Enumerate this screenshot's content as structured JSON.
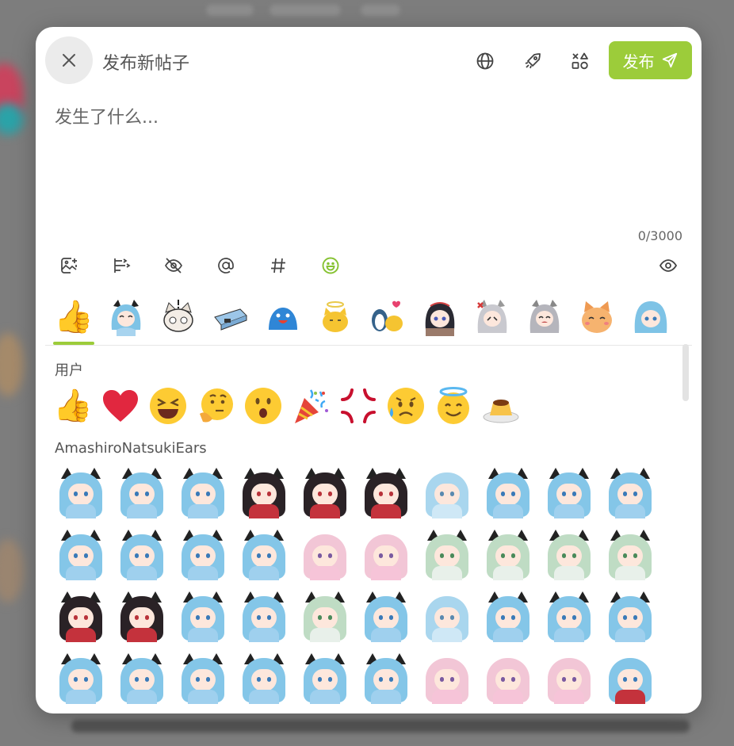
{
  "header": {
    "title": "发布新帖子",
    "publish_label": "发布",
    "icons": [
      "close-icon",
      "globe-icon",
      "rocket-icon",
      "shapes-icon",
      "send-icon"
    ]
  },
  "editor": {
    "placeholder": "发生了什么...",
    "value": "",
    "counter": "0/3000"
  },
  "toolbar": {
    "icons": [
      "add-image-icon",
      "poll-icon",
      "hide-icon",
      "mention-icon",
      "hashtag-icon",
      "emoji-icon",
      "preview-eye-icon"
    ],
    "active_icon": "emoji-icon"
  },
  "emoji_picker": {
    "pack_tabs": [
      {
        "name": "user-pack",
        "icon": "thumbs-up-emoji",
        "active": true
      },
      {
        "name": "AmashiroNatsukiEars",
        "icon": "blue-hair-girl-sticker"
      },
      {
        "name": "pack-3",
        "icon": "cat-surprised-sticker"
      },
      {
        "name": "pack-4",
        "icon": "box-robot-sticker"
      },
      {
        "name": "pack-5",
        "icon": "blue-bird-sticker"
      },
      {
        "name": "pack-6",
        "icon": "yellow-angel-cat-sticker"
      },
      {
        "name": "pack-7",
        "icon": "penguin-heart-sticker"
      },
      {
        "name": "pack-8",
        "icon": "dark-hair-girl-sticker"
      },
      {
        "name": "pack-9",
        "icon": "silver-hair-angry-sticker"
      },
      {
        "name": "pack-10",
        "icon": "silver-hair-cry-sticker"
      },
      {
        "name": "pack-11",
        "icon": "orange-cat-sticker"
      },
      {
        "name": "pack-12",
        "icon": "blue-hair-girl-sticker"
      }
    ],
    "sections": [
      {
        "title": "用户",
        "emojis": [
          "👍",
          "❤️",
          "😆",
          "🤔",
          "😮",
          "🎉",
          "💢",
          "😥",
          "😇",
          "🍮"
        ]
      },
      {
        "title": "AmashiroNatsukiEars",
        "sticker_rows": [
          [
            "blue",
            "blue",
            "blue",
            "dark-red",
            "dark-red",
            "dark-red",
            "blue-sleep",
            "blue",
            "blue",
            "blue"
          ],
          [
            "blue",
            "blue",
            "blue",
            "blue",
            "pink",
            "pink",
            "green",
            "green",
            "green",
            "green"
          ],
          [
            "dark-red",
            "dark-red",
            "blue",
            "blue",
            "green",
            "blue",
            "blue-sleep",
            "blue",
            "blue",
            "blue"
          ],
          [
            "blue",
            "blue",
            "blue",
            "blue",
            "blue",
            "blue",
            "pink",
            "pink",
            "pink",
            "blue-red"
          ]
        ]
      }
    ]
  },
  "colors": {
    "accent": "#9ccc3a",
    "overlay": "#7d7d7d",
    "modal_bg": "#ffffff"
  }
}
